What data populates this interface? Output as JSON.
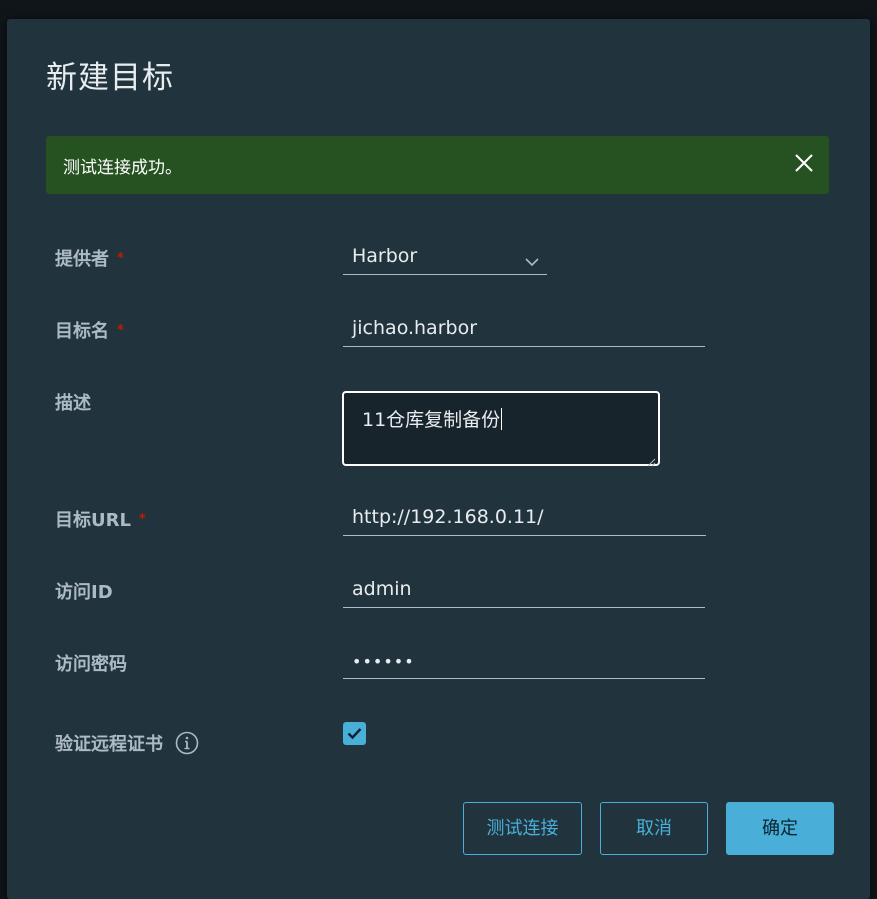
{
  "dialog": {
    "title": "新建目标"
  },
  "alert": {
    "message": "测试连接成功。",
    "close_icon": "close-icon",
    "background_color": "#255220"
  },
  "form": {
    "provider": {
      "label": "提供者",
      "required_mark": "*",
      "value": "Harbor"
    },
    "target_name": {
      "label": "目标名",
      "required_mark": "*",
      "value": "jichao.harbor"
    },
    "description": {
      "label": "描述",
      "value": "11仓库复制备份"
    },
    "target_url": {
      "label": "目标URL",
      "required_mark": "*",
      "value": "http://192.168.0.11/"
    },
    "access_id": {
      "label": "访问ID",
      "value": "admin"
    },
    "access_secret": {
      "label": "访问密码",
      "value": "••••••"
    },
    "verify_cert": {
      "label": "验证远程证书",
      "checked": true,
      "info_icon": "info-icon"
    }
  },
  "buttons": {
    "test": "测试连接",
    "cancel": "取消",
    "ok": "确定"
  },
  "colors": {
    "accent": "#49afd9",
    "required": "#c21d00",
    "modal_bg": "#21333d"
  }
}
